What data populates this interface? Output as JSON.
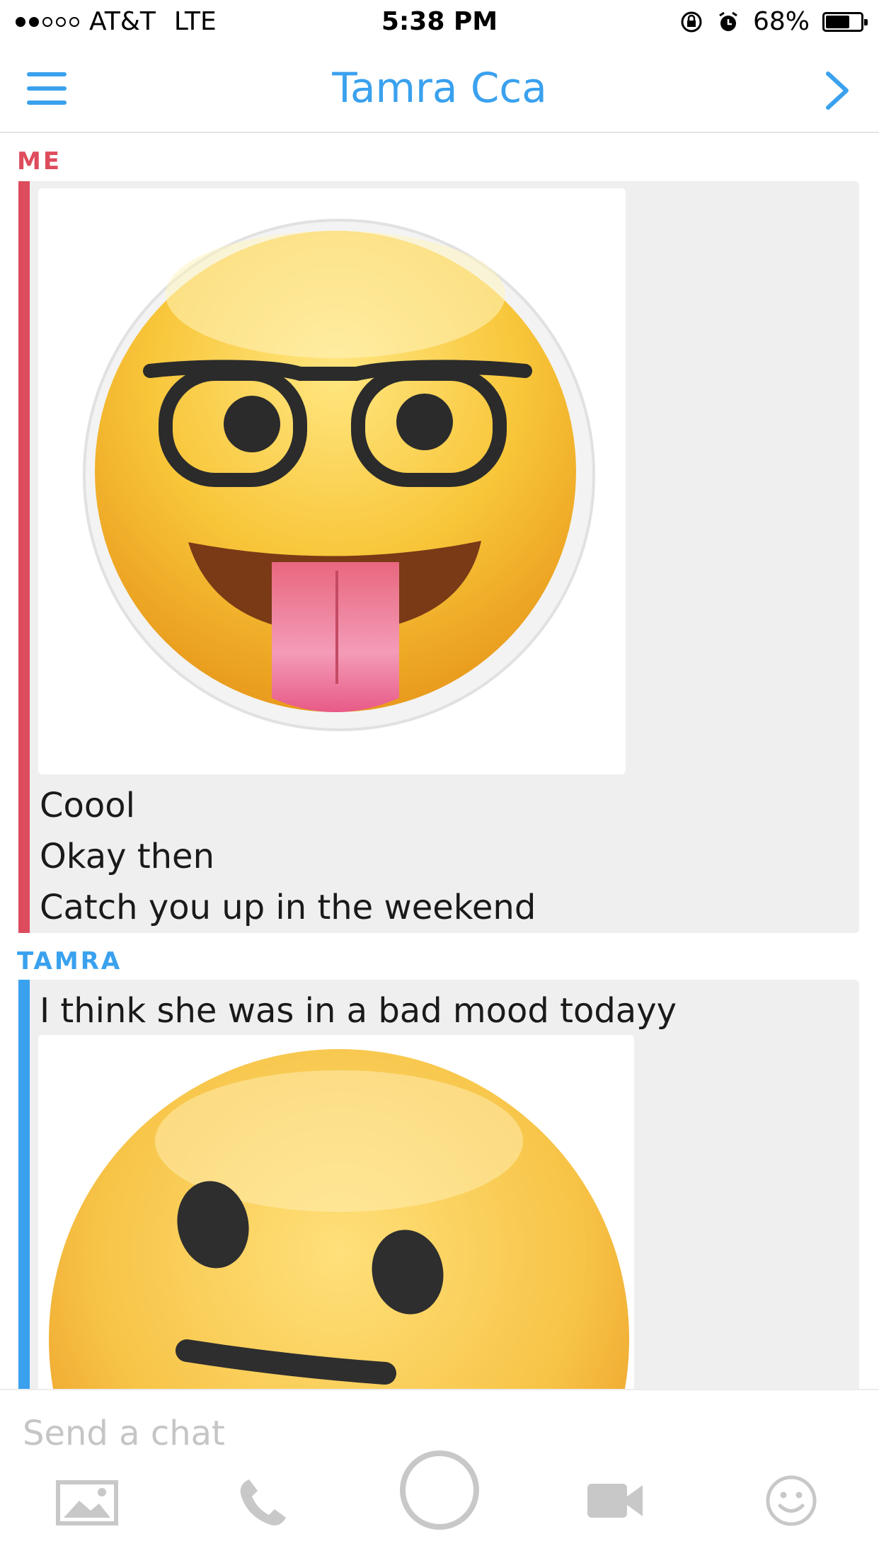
{
  "status_bar": {
    "carrier": "AT&T",
    "network": "LTE",
    "time": "5:38 PM",
    "battery": "68%",
    "battery_level": 0.68
  },
  "header": {
    "title": "Tamra Cca",
    "accent_color": "#3aa1ee"
  },
  "messages": {
    "me_label": "ME",
    "me_color": "#dd4c5d",
    "me_texts": [
      "Coool",
      "Okay then",
      "Catch you up in the weekend"
    ],
    "tamra_label": "TAMRA",
    "tamra_color": "#3aa1ee",
    "tamra_texts": [
      "I think she was in a bad mood todayy"
    ],
    "stickers": [
      "nerd-face-tongue-sticker",
      "smirk-face-sticker"
    ]
  },
  "input": {
    "placeholder": "Send a chat"
  },
  "toolbar": {
    "icons": [
      "image-icon",
      "phone-icon",
      "capture-circle-icon",
      "video-icon",
      "smiley-icon"
    ]
  }
}
